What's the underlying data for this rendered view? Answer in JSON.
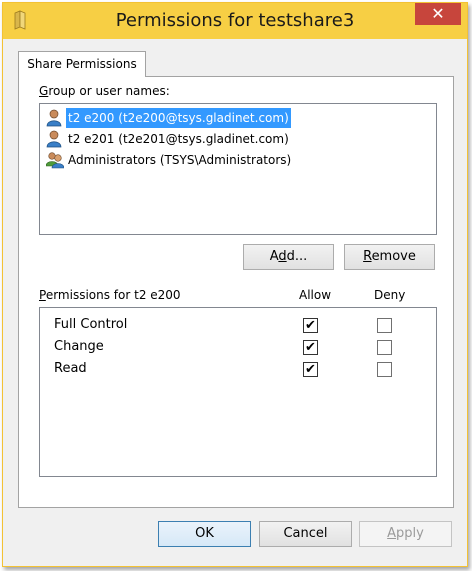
{
  "window": {
    "title": "Permissions for testshare3",
    "close_glyph": "✕"
  },
  "tabs": [
    {
      "label": "Share Permissions"
    }
  ],
  "group_label_prefix": "G",
  "group_label_rest": "roup or user names:",
  "users": [
    {
      "name": "t2 e200 (t2e200@tsys.gladinet.com)",
      "icon": "user-icon",
      "selected": true
    },
    {
      "name": "t2 e201 (t2e201@tsys.gladinet.com)",
      "icon": "user-icon",
      "selected": false
    },
    {
      "name": "Administrators (TSYS\\Administrators)",
      "icon": "group-icon",
      "selected": false
    }
  ],
  "buttons": {
    "add_pre": "A",
    "add_ul": "d",
    "add_post": "d...",
    "remove_ul": "R",
    "remove_post": "emove",
    "ok": "OK",
    "cancel": "Cancel",
    "apply_ul": "A",
    "apply_post": "pply"
  },
  "permissions": {
    "label_prefix": "P",
    "label_rest": "ermissions for t2 e200",
    "allow_header": "Allow",
    "deny_header": "Deny",
    "rows": [
      {
        "name": "Full Control",
        "allow": true,
        "deny": false
      },
      {
        "name": "Change",
        "allow": true,
        "deny": false
      },
      {
        "name": "Read",
        "allow": true,
        "deny": false
      }
    ],
    "check_glyph": "✔"
  },
  "colors": {
    "titlebar": "#f7cf44",
    "selection": "#3399ff",
    "close": "#c7453c"
  }
}
